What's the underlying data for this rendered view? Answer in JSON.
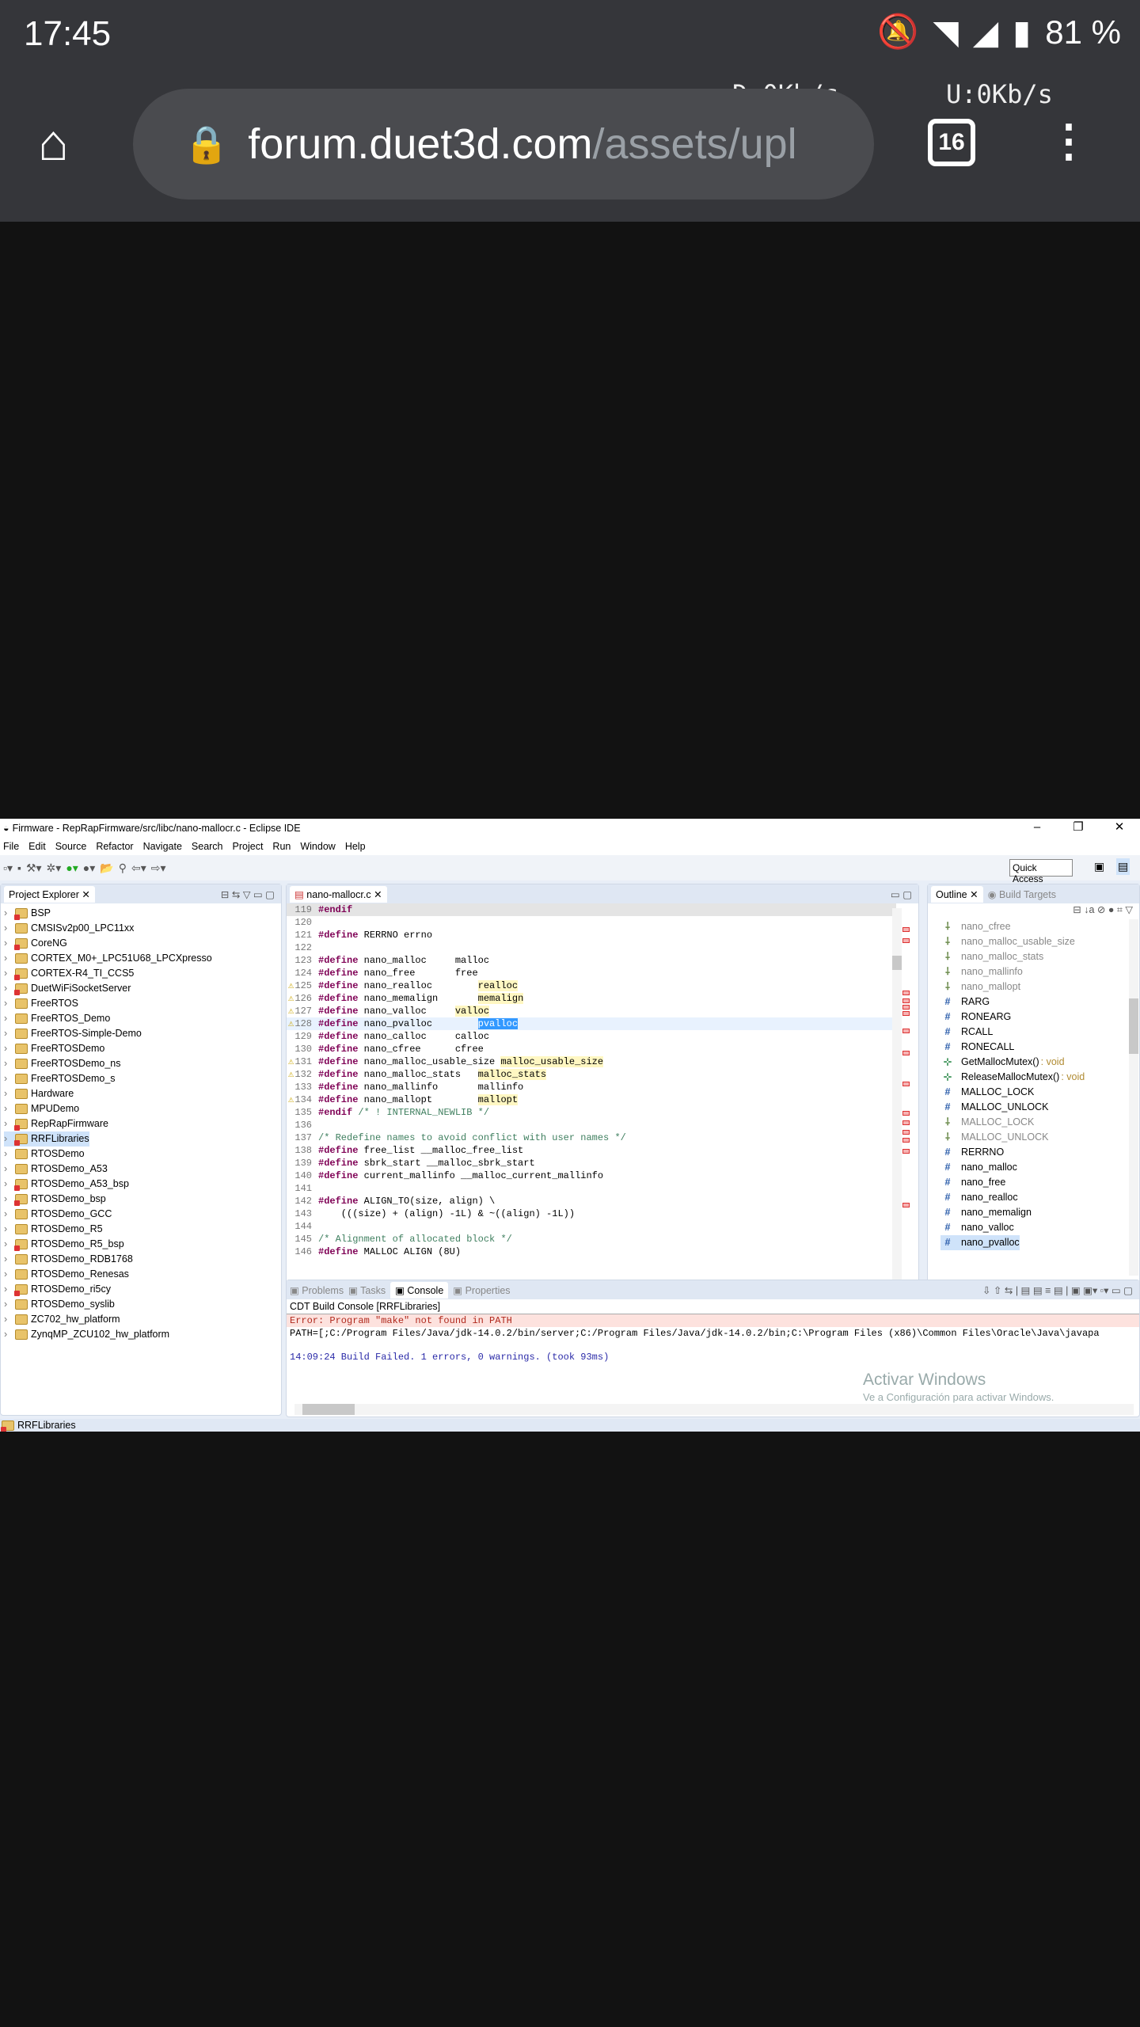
{
  "status_bar": {
    "time": "17:45",
    "battery": "81 %",
    "download": "D:0Kb/s",
    "upload": "U:0Kb/s"
  },
  "browser": {
    "url_host": "forum.duet3d.com",
    "url_path": "/assets/upl",
    "tab_count": "16"
  },
  "ide": {
    "title": "Firmware - RepRapFirmware/src/libc/nano-mallocr.c - Eclipse IDE",
    "menu": [
      "File",
      "Edit",
      "Source",
      "Refactor",
      "Navigate",
      "Search",
      "Project",
      "Run",
      "Window",
      "Help"
    ],
    "quick_access": "Quick Access",
    "project_explorer": {
      "tab": "Project Explorer",
      "items": [
        "BSP",
        "CMSISv2p00_LPC11xx",
        "CoreNG",
        "CORTEX_M0+_LPC51U68_LPCXpresso",
        "CORTEX-R4_TI_CCS5",
        "DuetWiFiSocketServer",
        "FreeRTOS",
        "FreeRTOS_Demo",
        "FreeRTOS-Simple-Demo",
        "FreeRTOSDemo",
        "FreeRTOSDemo_ns",
        "FreeRTOSDemo_s",
        "Hardware",
        "MPUDemo",
        "RepRapFirmware",
        "RRFLibraries",
        "RTOSDemo",
        "RTOSDemo_A53",
        "RTOSDemo_A53_bsp",
        "RTOSDemo_bsp",
        "RTOSDemo_GCC",
        "RTOSDemo_R5",
        "RTOSDemo_R5_bsp",
        "RTOSDemo_RDB1768",
        "RTOSDemo_Renesas",
        "RTOSDemo_ri5cy",
        "RTOSDemo_syslib",
        "ZC702_hw_platform",
        "ZynqMP_ZCU102_hw_platform"
      ],
      "selected": "RRFLibraries"
    },
    "editor": {
      "tab": "nano-mallocr.c",
      "lines": [
        {
          "n": "119",
          "t": [
            [
              "#endif",
              "kw"
            ]
          ]
        },
        {
          "n": "120",
          "t": []
        },
        {
          "n": "121",
          "t": [
            [
              "#define",
              "kw"
            ],
            [
              " RERRNO errno",
              ""
            ]
          ]
        },
        {
          "n": "122",
          "t": []
        },
        {
          "n": "123",
          "t": [
            [
              "#define",
              "kw"
            ],
            [
              " nano_malloc     malloc",
              ""
            ]
          ]
        },
        {
          "n": "124",
          "t": [
            [
              "#define",
              "kw"
            ],
            [
              " nano_free       free",
              ""
            ]
          ]
        },
        {
          "n": "125",
          "t": [
            [
              "#define",
              "kw"
            ],
            [
              " nano_realloc        ",
              ""
            ],
            [
              "realloc",
              "mac"
            ]
          ]
        },
        {
          "n": "126",
          "t": [
            [
              "#define",
              "kw"
            ],
            [
              " nano_memalign       ",
              ""
            ],
            [
              "memalign",
              "mac"
            ]
          ]
        },
        {
          "n": "127",
          "t": [
            [
              "#define",
              "kw"
            ],
            [
              " nano_valloc     ",
              ""
            ],
            [
              "valloc",
              "mac"
            ]
          ]
        },
        {
          "n": "128",
          "t": [
            [
              "#define",
              "kw"
            ],
            [
              " nano_pvalloc        ",
              ""
            ],
            [
              "pvalloc",
              "hl"
            ]
          ]
        },
        {
          "n": "129",
          "t": [
            [
              "#define",
              "kw"
            ],
            [
              " nano_calloc     calloc",
              ""
            ]
          ]
        },
        {
          "n": "130",
          "t": [
            [
              "#define",
              "kw"
            ],
            [
              " nano_cfree      cfree",
              ""
            ]
          ]
        },
        {
          "n": "131",
          "t": [
            [
              "#define",
              "kw"
            ],
            [
              " nano_malloc_usable_size ",
              ""
            ],
            [
              "malloc_usable_size",
              "mac"
            ]
          ]
        },
        {
          "n": "132",
          "t": [
            [
              "#define",
              "kw"
            ],
            [
              " nano_malloc_stats   ",
              ""
            ],
            [
              "malloc_stats",
              "mac"
            ]
          ]
        },
        {
          "n": "133",
          "t": [
            [
              "#define",
              "kw"
            ],
            [
              " nano_mallinfo       mallinfo",
              ""
            ]
          ]
        },
        {
          "n": "134",
          "t": [
            [
              "#define",
              "kw"
            ],
            [
              " nano_mallopt        ",
              ""
            ],
            [
              "mallopt",
              "mac"
            ]
          ]
        },
        {
          "n": "135",
          "t": [
            [
              "#endif",
              "kw"
            ],
            [
              " /* ! INTERNAL_NEWLIB */",
              "cm"
            ]
          ]
        },
        {
          "n": "136",
          "t": []
        },
        {
          "n": "137",
          "t": [
            [
              "/* Redefine names to avoid conflict with user names */",
              "cm"
            ]
          ]
        },
        {
          "n": "138",
          "t": [
            [
              "#define",
              "kw"
            ],
            [
              " free_list __malloc_free_list",
              ""
            ]
          ]
        },
        {
          "n": "139",
          "t": [
            [
              "#define",
              "kw"
            ],
            [
              " sbrk_start __malloc_sbrk_start",
              ""
            ]
          ]
        },
        {
          "n": "140",
          "t": [
            [
              "#define",
              "kw"
            ],
            [
              " current_mallinfo __malloc_current_mallinfo",
              ""
            ]
          ]
        },
        {
          "n": "141",
          "t": []
        },
        {
          "n": "142",
          "t": [
            [
              "#define",
              "kw"
            ],
            [
              " ALIGN_TO(size, align) \\",
              ""
            ]
          ]
        },
        {
          "n": "143",
          "t": [
            [
              "    (((size) + (align) -1L) & ~((align) -1L))",
              ""
            ]
          ]
        },
        {
          "n": "144",
          "t": []
        },
        {
          "n": "145",
          "t": [
            [
              "/* Alignment of allocated block */",
              "cm"
            ]
          ]
        },
        {
          "n": "146",
          "t": [
            [
              "#define",
              "kw"
            ],
            [
              " MALLOC ALIGN (8U)",
              ""
            ]
          ]
        }
      ]
    },
    "outline": {
      "tab": "Outline",
      "other_tab": "Build Targets",
      "items": [
        {
          "label": "nano_cfree",
          "kind": "inactive"
        },
        {
          "label": "nano_malloc_usable_size",
          "kind": "inactive"
        },
        {
          "label": "nano_malloc_stats",
          "kind": "inactive"
        },
        {
          "label": "nano_mallinfo",
          "kind": "inactive"
        },
        {
          "label": "nano_mallopt",
          "kind": "inactive"
        },
        {
          "label": "RARG",
          "kind": "macro"
        },
        {
          "label": "RONEARG",
          "kind": "macro"
        },
        {
          "label": "RCALL",
          "kind": "macro"
        },
        {
          "label": "RONECALL",
          "kind": "macro"
        },
        {
          "label": "GetMallocMutex()",
          "type": ": void",
          "kind": "function"
        },
        {
          "label": "ReleaseMallocMutex()",
          "type": ": void",
          "kind": "function"
        },
        {
          "label": "MALLOC_LOCK",
          "kind": "macro"
        },
        {
          "label": "MALLOC_UNLOCK",
          "kind": "macro"
        },
        {
          "label": "MALLOC_LOCK",
          "kind": "inactive"
        },
        {
          "label": "MALLOC_UNLOCK",
          "kind": "inactive"
        },
        {
          "label": "RERRNO",
          "kind": "macro"
        },
        {
          "label": "nano_malloc",
          "kind": "macro"
        },
        {
          "label": "nano_free",
          "kind": "macro"
        },
        {
          "label": "nano_realloc",
          "kind": "macro"
        },
        {
          "label": "nano_memalign",
          "kind": "macro"
        },
        {
          "label": "nano_valloc",
          "kind": "macro"
        },
        {
          "label": "nano_pvalloc",
          "kind": "macro",
          "selected": true
        }
      ]
    },
    "console": {
      "tabs": [
        "Problems",
        "Tasks",
        "Console",
        "Properties"
      ],
      "active_tab": "Console",
      "title": "CDT Build Console [RRFLibraries]",
      "error": "Error: Program \"make\" not found in PATH",
      "path": "PATH=[;C:/Program Files/Java/jdk-14.0.2/bin/server;C:/Program Files/Java/jdk-14.0.2/bin;C:\\Program Files (x86)\\Common Files\\Oracle\\Java\\javapa",
      "result": "14:09:24 Build Failed. 1 errors, 0 warnings. (took 93ms)"
    },
    "watermark": {
      "title": "Activar Windows",
      "subtitle": "Ve a Configuración para activar Windows."
    },
    "status": "RRFLibraries"
  }
}
